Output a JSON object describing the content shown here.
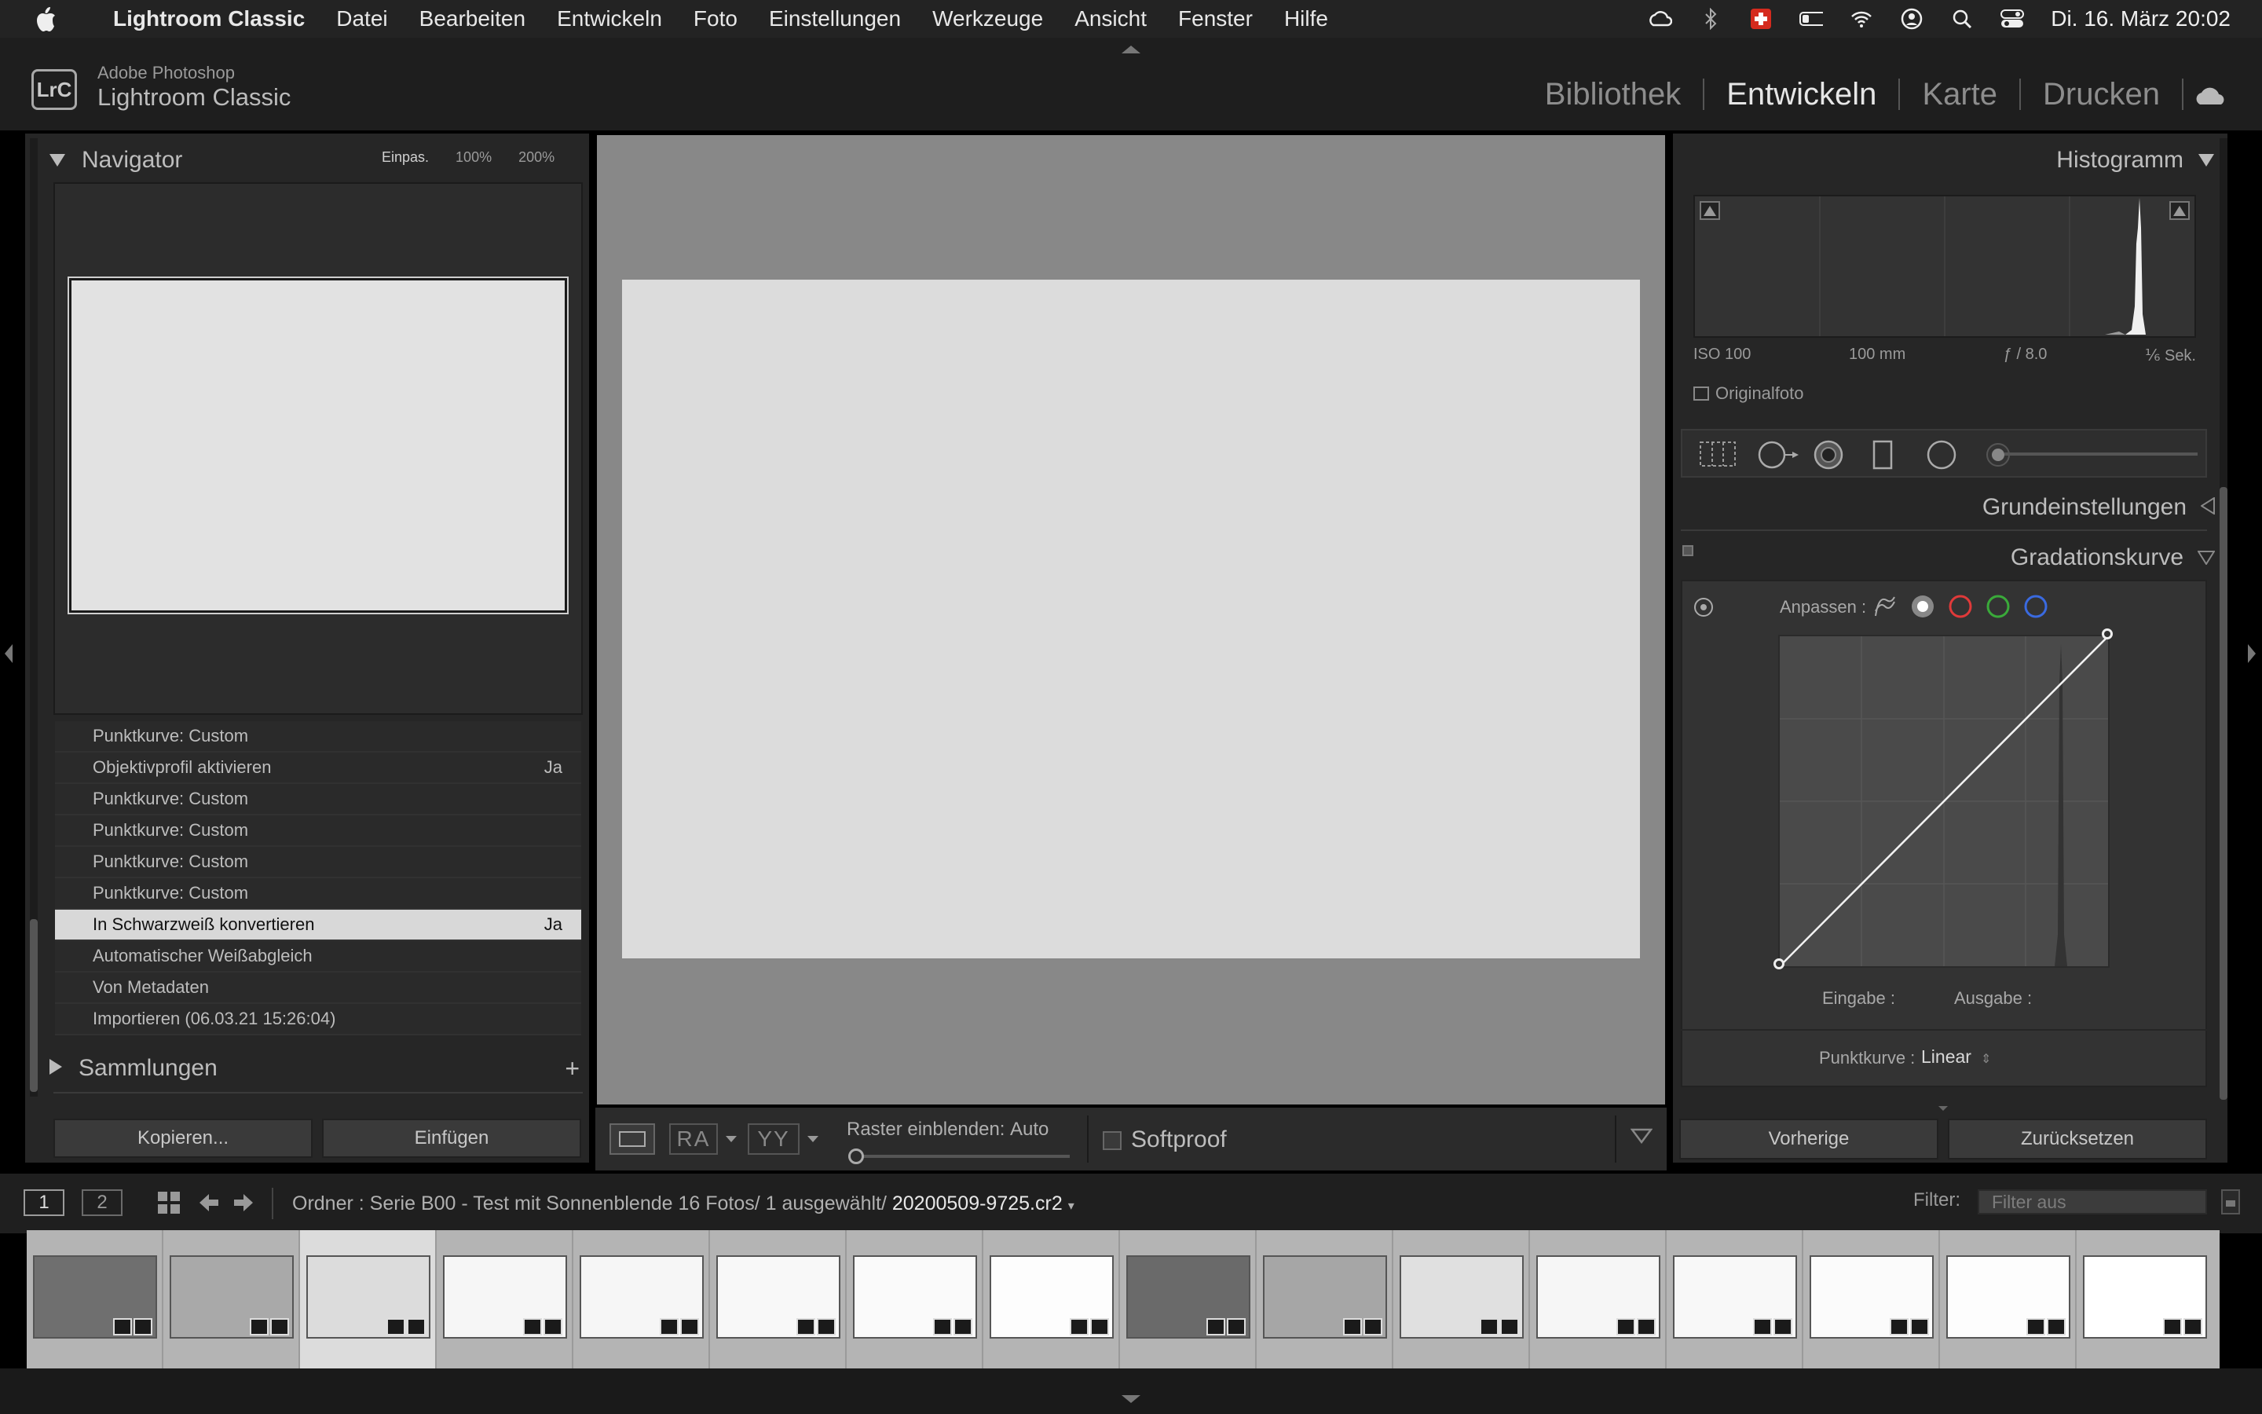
{
  "menubar": {
    "app_name": "Lightroom Classic",
    "items": [
      "Datei",
      "Bearbeiten",
      "Entwickeln",
      "Foto",
      "Einstellungen",
      "Werkzeuge",
      "Ansicht",
      "Fenster",
      "Hilfe"
    ],
    "clock": "Di. 16. März  20:02"
  },
  "brand": {
    "logo": "LrC",
    "line1": "Adobe Photoshop",
    "line2": "Lightroom Classic"
  },
  "modules": [
    "Bibliothek",
    "Entwickeln",
    "Karte",
    "Drucken"
  ],
  "active_module": "Entwickeln",
  "navigator": {
    "title": "Navigator",
    "zoom_options": [
      "Einpas.",
      "100%",
      "200%"
    ]
  },
  "history": [
    {
      "label": "Punktkurve: Custom",
      "value": ""
    },
    {
      "label": "Objektivprofil aktivieren",
      "value": "Ja"
    },
    {
      "label": "Punktkurve: Custom",
      "value": ""
    },
    {
      "label": "Punktkurve: Custom",
      "value": ""
    },
    {
      "label": "Punktkurve: Custom",
      "value": ""
    },
    {
      "label": "Punktkurve: Custom",
      "value": ""
    },
    {
      "label": "In Schwarzweiß konvertieren",
      "value": "Ja",
      "selected": true
    },
    {
      "label": "Automatischer Weißabgleich",
      "value": ""
    },
    {
      "label": "Von Metadaten",
      "value": ""
    },
    {
      "label": "Importieren (06.03.21 15:26:04)",
      "value": ""
    }
  ],
  "collections": {
    "title": "Sammlungen",
    "add": "+"
  },
  "left_buttons": {
    "copy": "Kopieren...",
    "paste": "Einfügen"
  },
  "toolbar": {
    "grid_label": "Raster einblenden:",
    "grid_value": "Auto",
    "softproof": "Softproof"
  },
  "histogram": {
    "title": "Histogramm",
    "iso": "ISO 100",
    "focal": "100 mm",
    "aperture": "ƒ / 8.0",
    "shutter": "⅙ Sek.",
    "original": "Originalfoto"
  },
  "panels": {
    "basic": "Grundeinstellungen",
    "tone_curve": "Gradationskurve"
  },
  "curve": {
    "adjust_label": "Anpassen :",
    "input_label": "Eingabe :",
    "output_label": "Ausgabe :",
    "point_curve_label": "Punktkurve :",
    "point_curve_value": "Linear",
    "channel_colors": [
      "#ffffff",
      "#e03a3a",
      "#3aaa3a",
      "#3a6ae0"
    ]
  },
  "right_buttons": {
    "previous": "Vorherige",
    "reset": "Zurücksetzen"
  },
  "filmstrip_header": {
    "screen1": "1",
    "screen2": "2",
    "path": "Ordner : Serie B00 - Test mit Sonnenblende   16 Fotos/  1 ausgewählt/",
    "filename": "20200509-9725.cr2",
    "filter_label": "Filter:",
    "filter_value": "Filter aus"
  },
  "thumbnails": [
    {
      "tone": "#6f6f6f"
    },
    {
      "tone": "#a9a9a9"
    },
    {
      "tone": "#dcdcdc",
      "selected": true
    },
    {
      "tone": "#f6f6f6"
    },
    {
      "tone": "#f6f6f6"
    },
    {
      "tone": "#f8f8f8"
    },
    {
      "tone": "#fafafa"
    },
    {
      "tone": "#fdfdfd"
    },
    {
      "tone": "#6a6a6a"
    },
    {
      "tone": "#a6a6a6"
    },
    {
      "tone": "#e0e0e0"
    },
    {
      "tone": "#f6f6f6"
    },
    {
      "tone": "#f8f8f8"
    },
    {
      "tone": "#fbfbfb"
    },
    {
      "tone": "#fdfdfd"
    },
    {
      "tone": "#ffffff"
    }
  ]
}
